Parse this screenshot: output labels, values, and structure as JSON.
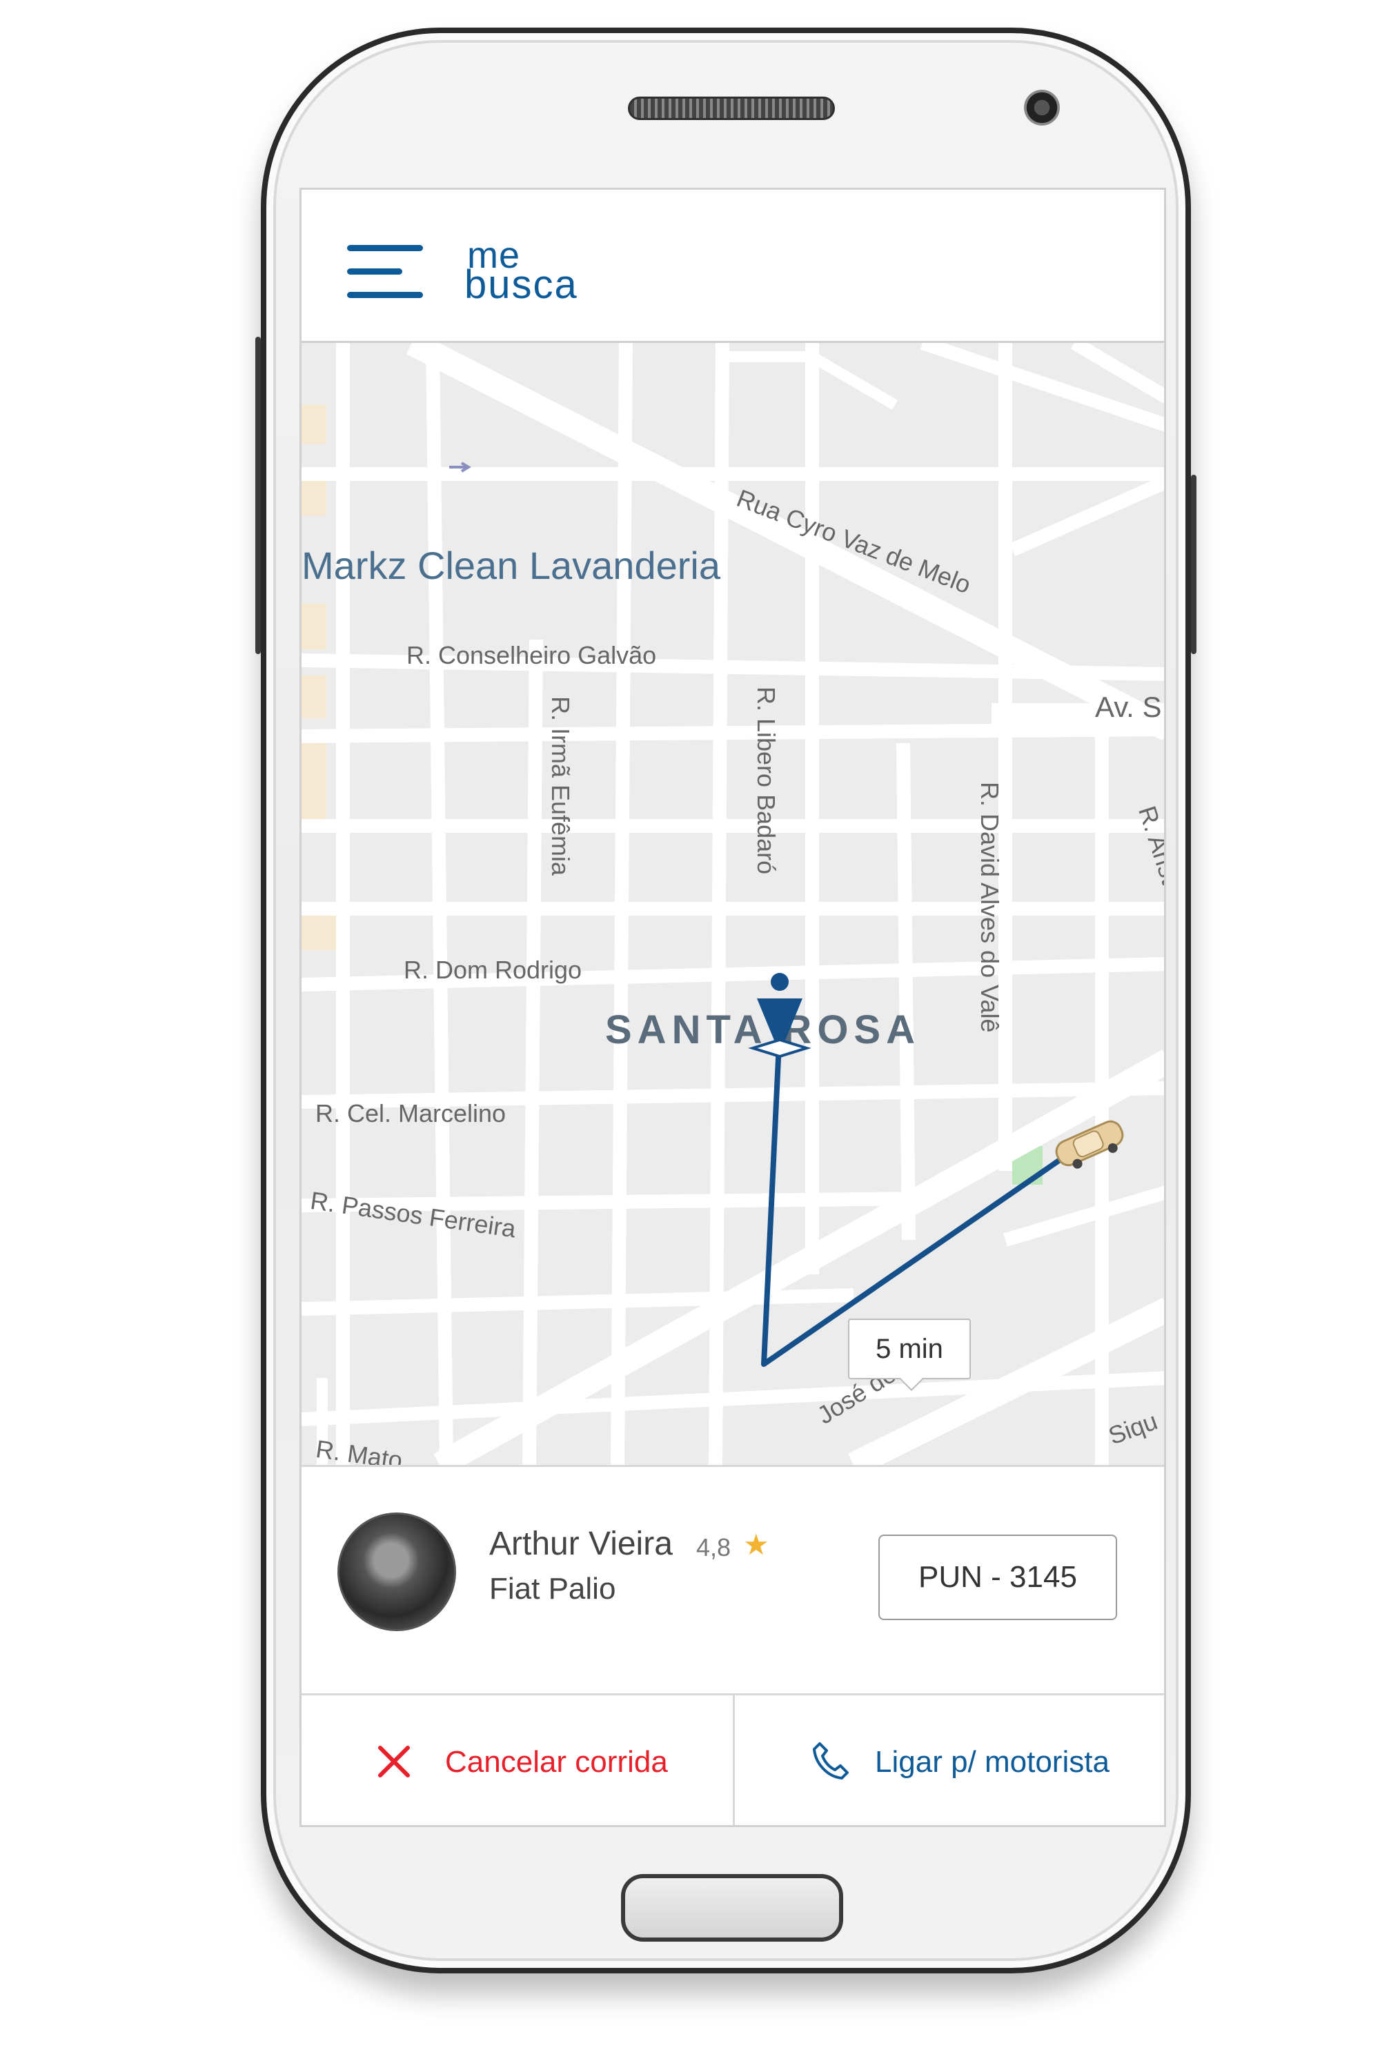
{
  "app": {
    "logo_line1": "me",
    "logo_line2": "busca"
  },
  "map": {
    "streets": [
      "Rua Cyro Vaz de Melo",
      "R. Conselheiro Galvão",
      "R. Irmã Eufêmia",
      "R. Libero Badaró",
      "R. David Alves do Valê",
      "R. Aristóteles R",
      "Av. S",
      "R. Dom Rodrigo",
      "R. Cel. Marcelino",
      "R. Passos Ferreira",
      "José de Melo",
      "R. Mato",
      "Siqu"
    ],
    "poi": "Markz Clean Lavanderia",
    "district": "SANTA ROSA",
    "eta": "5 min"
  },
  "driver": {
    "name": "Arthur Vieira",
    "rating": "4,8",
    "car": "Fiat Palio",
    "plate": "PUN - 3145"
  },
  "actions": {
    "cancel_label": "Cancelar corrida",
    "call_label": "Ligar p/ motorista"
  },
  "colors": {
    "brand": "#0e5b9a",
    "cancel": "#e8202a",
    "route": "#16508a",
    "star": "#f2b431"
  },
  "icons": {
    "menu": "hamburger-menu-icon",
    "cancel": "close-icon",
    "call": "phone-icon",
    "star": "star-icon",
    "pin": "user-location-pin-icon",
    "car": "car-icon"
  }
}
